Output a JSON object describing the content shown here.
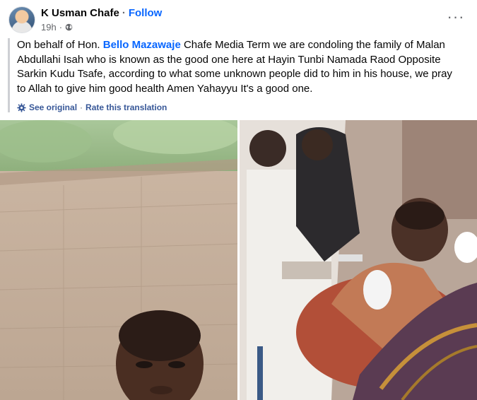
{
  "post": {
    "author": "K Usman Chafe",
    "separator": "·",
    "follow_label": "Follow",
    "time": "19h",
    "time_separator": "·",
    "audience_icon": "globe-icon",
    "more_icon": "more-horizontal-icon",
    "more_label": "···",
    "text_before_mention": "On behalf of Hon. ",
    "mention": "Bello Mazawaje",
    "text_after_mention": " Chafe Media Term we are condoling the family of Malan Abdullahi Isah who is known as the good one here at Hayin Tunbi Namada Raod Opposite Sarkin Kudu Tsafe, according to what some unknown people did to him in his house, we pray to Allah to give him good health Amen Yahayyu It's a good one.",
    "translation": {
      "icon": "gear-icon",
      "see_original": "See original",
      "separator": "·",
      "rate": "Rate this translation"
    }
  },
  "photos": [
    {
      "icon": "photo",
      "subject": "selfie-outdoor"
    },
    {
      "icon": "photo",
      "subject": "hospital-bed"
    }
  ],
  "colors": {
    "link_blue": "#0866ff",
    "muted_gray": "#65676b",
    "translate_blue": "#385898"
  }
}
